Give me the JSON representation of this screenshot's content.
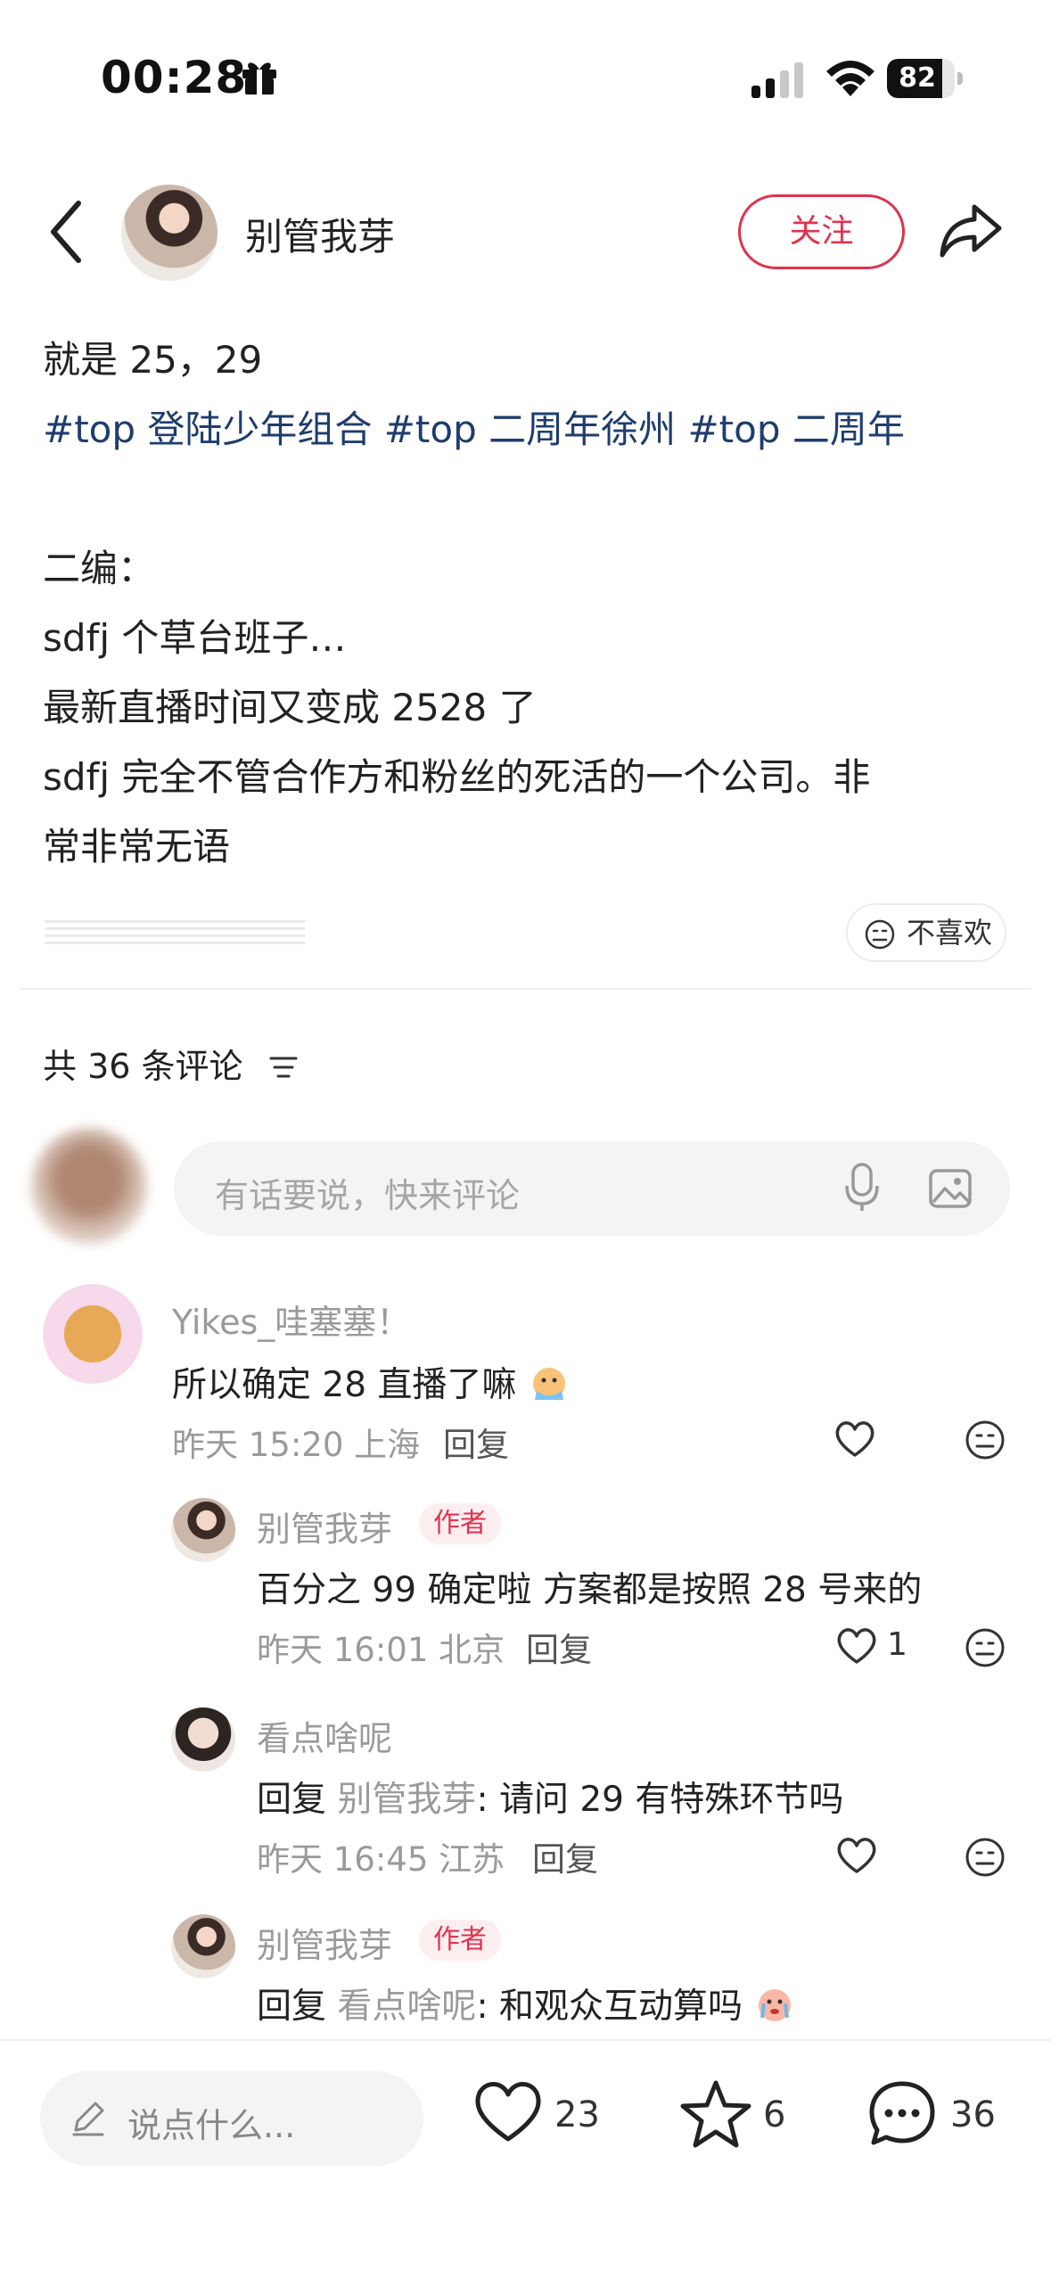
{
  "status_bar": {
    "time": "00:28",
    "battery": "82",
    "battery_fraction": 0.82
  },
  "header": {
    "author_name": "别管我芽",
    "follow_label": "关注"
  },
  "post": {
    "line1": "就是 25，29",
    "tags": [
      "#top 登陆少年组合",
      "#top 二周年徐州",
      "#top 二周年"
    ],
    "line3": "二编：",
    "line4": "sdfj 个草台班子…",
    "line5": "最新直播时间又变成 2528 了",
    "line6": "sdfj 完全不管合作方和粉丝的死活的一个公司。非",
    "line7": "常非常无语",
    "dislike_label": "不喜欢"
  },
  "comments_header": {
    "count_label": "共 36 条评论"
  },
  "comment_input": {
    "placeholder": "有话要说，快来评论"
  },
  "comments": [
    {
      "name": "Yikes_哇塞塞！",
      "text": "所以确定 28 直播了嘛",
      "time_loc": "昨天 15:20 上海",
      "reply_label": "回复",
      "likes": ""
    },
    {
      "name": "别管我芽",
      "badge": "作者",
      "text": "百分之 99 确定啦 方案都是按照 28 号来的",
      "time_loc": "昨天 16:01 北京",
      "reply_label": "回复",
      "likes": "1"
    },
    {
      "name": "看点啥呢",
      "reply_prefix": "回复",
      "reply_to": "别管我芽",
      "text": ": 请问 29 有特殊环节吗",
      "time_loc": "昨天 16:45 江苏",
      "reply_label": "回复",
      "likes": ""
    },
    {
      "name": "别管我芽",
      "badge": "作者",
      "reply_prefix": "回复",
      "reply_to": "看点啥呢",
      "text": ": 和观众互动算吗"
    }
  ],
  "bottom_bar": {
    "say_placeholder": "说点什么...",
    "likes": "23",
    "stars": "6",
    "comments": "36"
  },
  "colors": {
    "accent": "#e0334f",
    "hashtag": "#1f3d6e",
    "muted": "#9a9a9a"
  },
  "icons": [
    "gift-icon",
    "signal-icon",
    "wifi-icon",
    "battery-icon",
    "back-icon",
    "share-icon",
    "sort-icon",
    "mic-icon",
    "image-icon",
    "heart-icon",
    "emoji-icon",
    "pencil-icon",
    "star-icon",
    "comment-icon"
  ]
}
